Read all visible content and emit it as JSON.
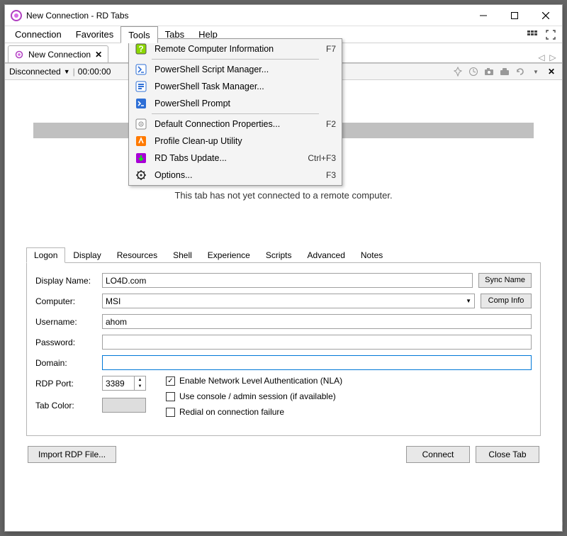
{
  "window": {
    "title": "New Connection - RD Tabs"
  },
  "menubar": {
    "items": [
      "Connection",
      "Favorites",
      "Tools",
      "Tabs",
      "Help"
    ],
    "open_index": 2
  },
  "doc_tab": {
    "label": "New Connection"
  },
  "status": {
    "state": "Disconnected",
    "time": "00:00:00"
  },
  "tools_menu": [
    {
      "icon": "question-icon",
      "color": "#8bd800",
      "label": "Remote Computer Information",
      "shortcut": "F7"
    },
    {
      "sep": true
    },
    {
      "icon": "ps-icon",
      "color": "#2e6fd6",
      "label": "PowerShell Script Manager..."
    },
    {
      "icon": "ps-task-icon",
      "color": "#2e6fd6",
      "label": "PowerShell Task Manager..."
    },
    {
      "icon": "ps-prompt-icon",
      "color": "#2e6fd6",
      "label": "PowerShell Prompt"
    },
    {
      "sep": true
    },
    {
      "icon": "properties-icon",
      "color": "#888",
      "label": "Default Connection Properties...",
      "shortcut": "F2"
    },
    {
      "icon": "cleanup-icon",
      "color": "#ff7a00",
      "label": "Profile Clean-up Utility"
    },
    {
      "icon": "update-icon",
      "color": "#a800d6",
      "label": "RD Tabs Update...",
      "shortcut": "Ctrl+F3"
    },
    {
      "icon": "options-icon",
      "color": "#222",
      "label": "Options...",
      "shortcut": "F3"
    }
  ],
  "message": "This tab has not yet connected to a remote computer.",
  "setting_tabs": [
    "Logon",
    "Display",
    "Resources",
    "Shell",
    "Experience",
    "Scripts",
    "Advanced",
    "Notes"
  ],
  "form": {
    "display_name": {
      "label": "Display Name:",
      "value": "LO4D.com"
    },
    "computer": {
      "label": "Computer:",
      "value": "MSI"
    },
    "username": {
      "label": "Username:",
      "value": "ahom"
    },
    "password": {
      "label": "Password:",
      "value": ""
    },
    "domain": {
      "label": "Domain:",
      "value": ""
    },
    "rdp_port": {
      "label": "RDP Port:",
      "value": "3389"
    },
    "tab_color": {
      "label": "Tab Color:"
    },
    "sync_name": "Sync Name",
    "comp_info": "Comp Info",
    "checks": {
      "nla": {
        "label": "Enable Network Level Authentication (NLA)",
        "checked": true
      },
      "console": {
        "label": "Use console / admin session (if available)",
        "checked": false
      },
      "redial": {
        "label": "Redial on connection failure",
        "checked": false
      }
    }
  },
  "buttons": {
    "import": "Import RDP File...",
    "connect": "Connect",
    "close_tab": "Close Tab"
  },
  "watermark": "LO4D.com"
}
